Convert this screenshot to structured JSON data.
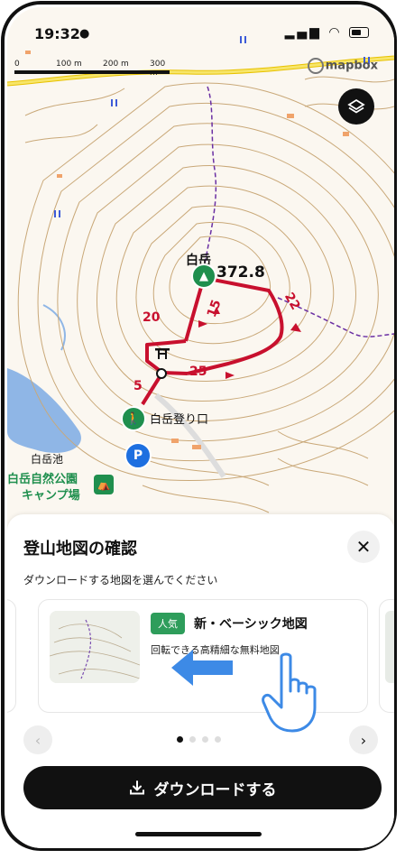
{
  "status_bar": {
    "time": "19:32",
    "person_icon": "person-icon",
    "signal_icon": "signal-icon",
    "wifi_icon": "wifi-icon",
    "battery_icon": "battery-icon"
  },
  "map": {
    "scale_labels": [
      "0",
      "100 m",
      "200 m",
      "300 m"
    ],
    "attribution": "mapbox",
    "peak_name": "白岳",
    "peak_elevation": "372.8",
    "trailhead_label": "白岳登り口",
    "pond_label": "白岳池",
    "campsite_label_line1": "白岳自然公園",
    "campsite_label_line2": "キャンプ場",
    "parking_label": "P",
    "trail_times": [
      "20",
      "15",
      "22",
      "25",
      "5"
    ],
    "colors": {
      "trail": "#c8102e",
      "contour": "#c9a878",
      "water": "#8fb6e6",
      "road": "#f2d000",
      "poi_green": "#1f8f4e",
      "parking": "#1d6fe0"
    }
  },
  "sheet": {
    "title": "登山地図の確認",
    "subtitle": "ダウンロードする地図を選んでください",
    "card": {
      "badge": "人気",
      "name": "新・ベーシック地図",
      "description": "回転できる高精細な無料地図"
    },
    "pagination": {
      "total": 4,
      "current": 1
    },
    "download_button": "ダウンロードする",
    "colors": {
      "badge": "#2e9d5b",
      "hint_arrow": "#3d8ae6"
    }
  }
}
